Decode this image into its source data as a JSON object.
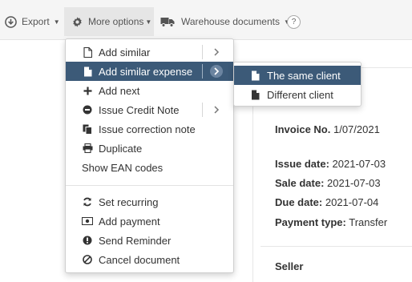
{
  "toolbar": {
    "export_label": "Export",
    "more_options_label": "More options",
    "warehouse_label": "Warehouse documents",
    "help_label": "?"
  },
  "menu": {
    "items": [
      {
        "label": "Add similar",
        "icon": "file-outline-icon",
        "has_submenu": true
      },
      {
        "label": "Add similar expense",
        "icon": "file-filled-icon",
        "has_submenu": true,
        "highlighted": true
      },
      {
        "label": "Add next",
        "icon": "plus-icon"
      },
      {
        "label": "Issue Credit Note",
        "icon": "minus-circle-icon",
        "has_submenu": true
      },
      {
        "label": "Issue correction note",
        "icon": "copy-file-icon"
      },
      {
        "label": "Duplicate",
        "icon": "print-icon"
      },
      {
        "label": "Show EAN codes",
        "icon": null
      },
      {
        "label": "Set recurring",
        "icon": "refresh-icon"
      },
      {
        "label": "Add payment",
        "icon": "money-icon"
      },
      {
        "label": "Send Reminder",
        "icon": "exclamation-circle-icon"
      },
      {
        "label": "Cancel document",
        "icon": "ban-icon"
      }
    ]
  },
  "submenu": {
    "items": [
      {
        "label": "The same client",
        "icon": "file-filled-icon",
        "highlighted": true
      },
      {
        "label": "Different client",
        "icon": "file-filled-icon"
      }
    ]
  },
  "invoice": {
    "number_label": "Invoice No.",
    "number_value": "1/07/2021",
    "issue_date_label": "Issue date:",
    "issue_date_value": "2021-07-03",
    "sale_date_label": "Sale date:",
    "sale_date_value": "2021-07-03",
    "due_date_label": "Due date:",
    "due_date_value": "2021-07-04",
    "payment_type_label": "Payment type:",
    "payment_type_value": "Transfer",
    "seller_label": "Seller"
  },
  "colors": {
    "highlight": "#3c5a78",
    "toolbar_bg": "#f5f5f5"
  }
}
